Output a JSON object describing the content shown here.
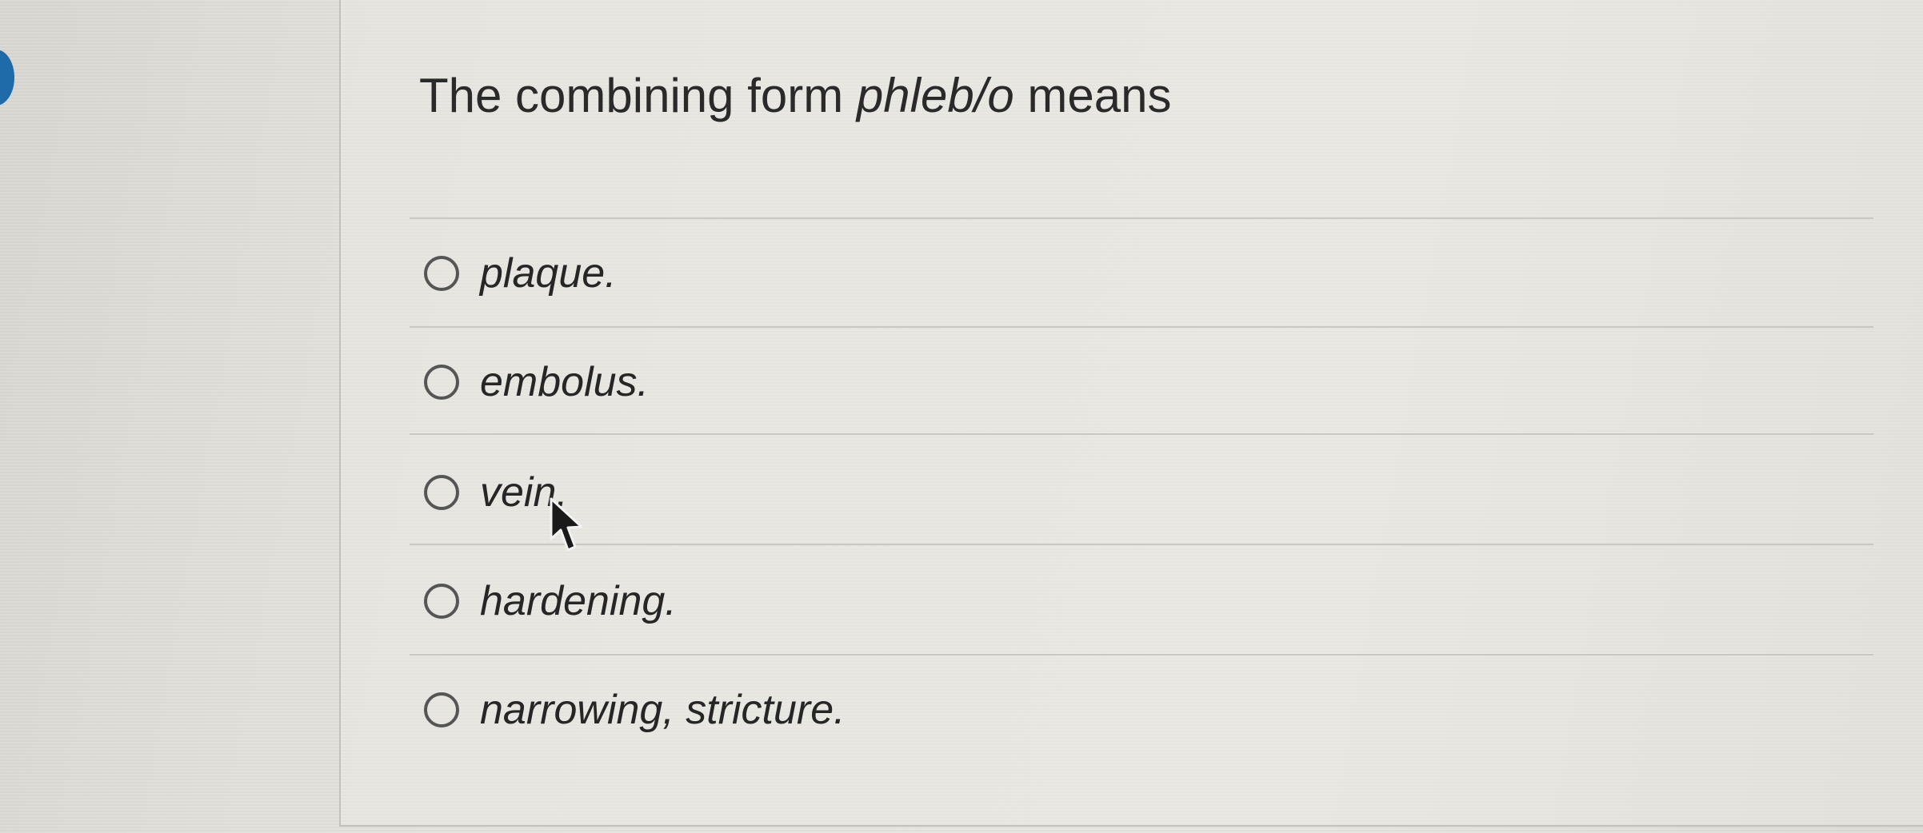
{
  "question": {
    "prefix": "The combining form ",
    "term": "phleb/o",
    "suffix": " means"
  },
  "options": [
    {
      "label": "plaque."
    },
    {
      "label": "embolus."
    },
    {
      "label": "vein."
    },
    {
      "label": "hardening."
    },
    {
      "label": "narrowing, stricture."
    }
  ],
  "selected_option": null,
  "accent_color": "#1f6aa8",
  "icons": [
    "radio-unchecked-icon",
    "mouse-pointer-icon"
  ]
}
